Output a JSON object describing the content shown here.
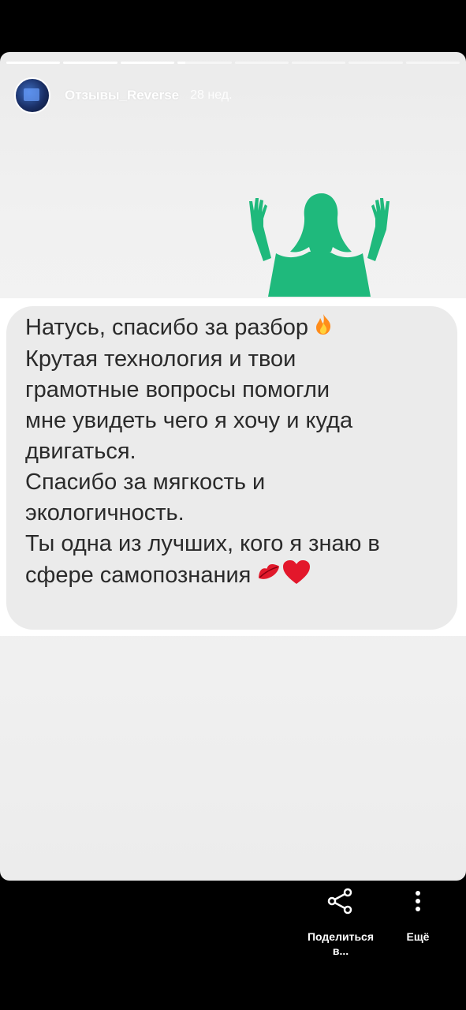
{
  "story": {
    "progress_segments": [
      1,
      1,
      1,
      0.15,
      0,
      0,
      0,
      0
    ],
    "username": "Отзывы_Reverse",
    "time_ago": "28 нед.",
    "message_lines": [
      "Натусь, спасибо за разбор",
      "Крутая технология и твои",
      "грамотные вопросы помогли",
      "мне увидеть чего я хочу и куда",
      "двигаться.",
      "Спасибо за мягкость и",
      "экологичность.",
      "Ты одна из лучших, кого я знаю в",
      "сфере самопознания"
    ],
    "emojis": {
      "line1": "fire",
      "line9": [
        "kiss-lips",
        "red-heart"
      ]
    },
    "silhouette_color": "#1fb97c"
  },
  "actions": {
    "share_label_1": "Поделиться",
    "share_label_2": "в...",
    "more_label": "Ещё"
  }
}
